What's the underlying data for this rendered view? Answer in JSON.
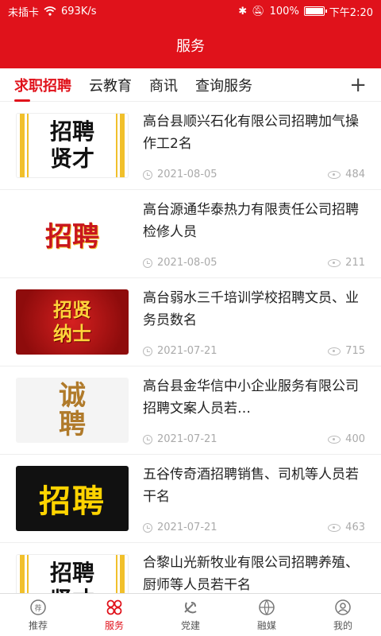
{
  "status_bar": {
    "carrier": "未插卡",
    "speed": "693K/s",
    "battery": "100%",
    "battery_level": 1.0,
    "time": "下午2:20"
  },
  "header": {
    "title": "服务"
  },
  "tabs": [
    {
      "label": "求职招聘",
      "active": true
    },
    {
      "label": "云教育",
      "active": false
    },
    {
      "label": "商讯",
      "active": false
    },
    {
      "label": "查询服务",
      "active": false
    }
  ],
  "tab_add_label": "+",
  "articles": [
    {
      "title": "高台县顺兴石化有限公司招聘加气操作工2名",
      "date": "2021-08-05",
      "views": "484",
      "thumb_text": "招聘\n贤才"
    },
    {
      "title": "高台源通华泰热力有限责任公司招聘检修人员",
      "date": "2021-08-05",
      "views": "211",
      "thumb_text": "招聘"
    },
    {
      "title": "高台弱水三千培训学校招聘文员、业务员数名",
      "date": "2021-07-21",
      "views": "715",
      "thumb_text": "招贤\n纳士"
    },
    {
      "title": "高台县金华信中小企业服务有限公司招聘文案人员若…",
      "date": "2021-07-21",
      "views": "400",
      "thumb_text": "诚\n聘"
    },
    {
      "title": "五谷传奇酒招聘销售、司机等人员若干名",
      "date": "2021-07-21",
      "views": "463",
      "thumb_text": "招聘"
    },
    {
      "title": "合黎山光新牧业有限公司招聘养殖、厨师等人员若干名",
      "date": "",
      "views": "",
      "thumb_text": "招聘\n贤才"
    }
  ],
  "bottom_nav": [
    {
      "label": "推荐",
      "icon": "recommend-icon",
      "active": false
    },
    {
      "label": "服务",
      "icon": "service-icon",
      "active": true
    },
    {
      "label": "党建",
      "icon": "party-icon",
      "active": false
    },
    {
      "label": "融媒",
      "icon": "media-icon",
      "active": false
    },
    {
      "label": "我的",
      "icon": "profile-icon",
      "active": false
    }
  ],
  "colors": {
    "brand_red": "#e0121b",
    "meta_gray": "#aaaaaa"
  }
}
